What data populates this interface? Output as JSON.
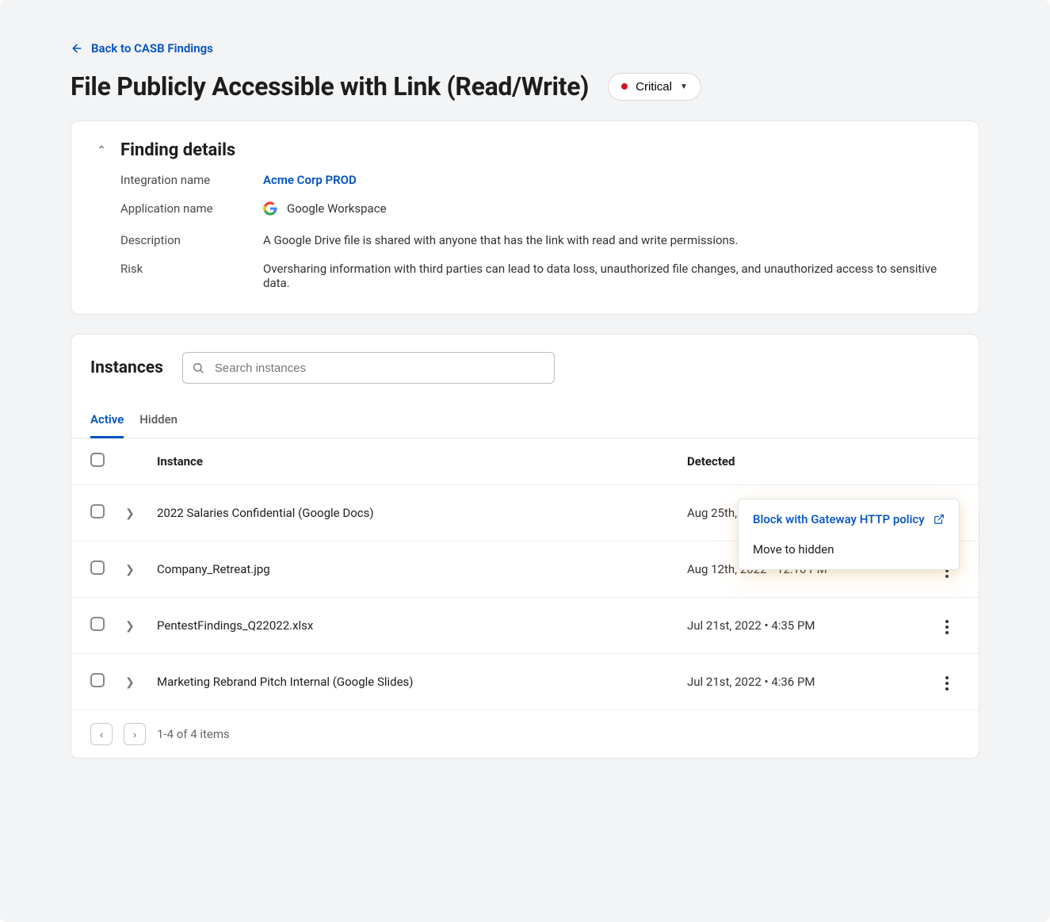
{
  "back_link": {
    "label": "Back to CASB Findings"
  },
  "page_title": "File Publicly Accessible with Link (Read/Write)",
  "severity": {
    "label": "Critical",
    "color": "#cf1322"
  },
  "details": {
    "section_title": "Finding details",
    "labels": {
      "integration": "Integration name",
      "application": "Application name",
      "description": "Description",
      "risk": "Risk"
    },
    "integration_name": "Acme Corp PROD",
    "application_name": "Google Workspace",
    "description_text": "A Google Drive file is shared with anyone that has the link with read and write permissions.",
    "risk_text": "Oversharing information with third parties can lead to data loss, unauthorized file changes, and unauthorized access to sensitive data."
  },
  "instances": {
    "section_title": "Instances",
    "search": {
      "placeholder": "Search instances"
    },
    "tabs": [
      {
        "id": "active",
        "label": "Active",
        "active": true
      },
      {
        "id": "hidden",
        "label": "Hidden",
        "active": false
      }
    ],
    "columns": {
      "instance": "Instance",
      "detected": "Detected"
    },
    "rows": [
      {
        "instance": "2022 Salaries Confidential (Google Docs)",
        "detected": "Aug 25th, 2022 • 12:10 PM",
        "menu_open": true
      },
      {
        "instance": "Company_Retreat.jpg",
        "detected": "Aug 12th, 2022 • 12:10 PM",
        "menu_open": false
      },
      {
        "instance": "PentestFindings_Q22022.xlsx",
        "detected": "Jul 21st, 2022 • 4:35 PM",
        "menu_open": false
      },
      {
        "instance": "Marketing Rebrand Pitch Internal (Google Slides)",
        "detected": "Jul 21st, 2022 • 4:36 PM",
        "menu_open": false
      }
    ],
    "pagination": {
      "status": "1-4 of 4 items"
    },
    "row_menu": {
      "block_label": "Block with Gateway HTTP policy",
      "hide_label": "Move to hidden"
    }
  }
}
